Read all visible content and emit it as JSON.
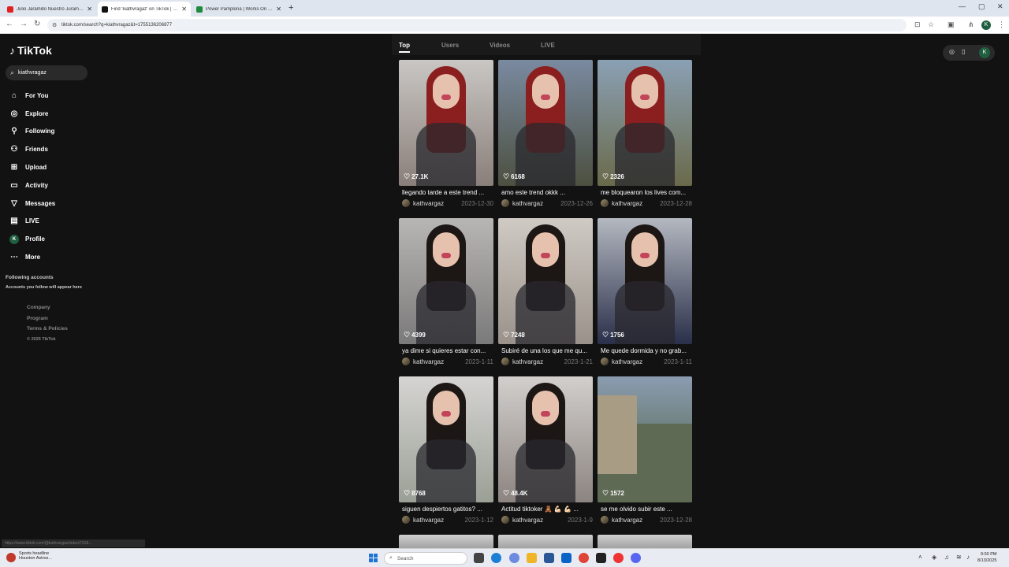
{
  "browser": {
    "tabs": [
      {
        "title": "Julio Jaramillo Nuestro Juramento",
        "favicon_color": "#e32020"
      },
      {
        "title": "Find 'kiathvragaz' on TikTok | TikTok Search",
        "favicon_color": "#111111"
      },
      {
        "title": "Power Pamplona | Works On C...",
        "favicon_color": "#1e8a3e"
      }
    ],
    "new_tab": "+",
    "url": "tiktok.com/search?q=kiathvragaz&t=1755136206877"
  },
  "sidebar": {
    "logo": "TikTok",
    "search_value": "kiathvragaz",
    "nav": [
      {
        "label": "For You",
        "icon": "home-icon"
      },
      {
        "label": "Explore",
        "icon": "compass-icon"
      },
      {
        "label": "Following",
        "icon": "following-icon"
      },
      {
        "label": "Friends",
        "icon": "friends-icon"
      },
      {
        "label": "Upload",
        "icon": "upload-icon"
      },
      {
        "label": "Activity",
        "icon": "activity-icon"
      },
      {
        "label": "Messages",
        "icon": "messages-icon"
      },
      {
        "label": "LIVE",
        "icon": "live-icon"
      },
      {
        "label": "Profile",
        "icon": "profile-avatar",
        "avatar_letter": "K"
      },
      {
        "label": "More",
        "icon": "more-icon"
      }
    ],
    "following_title": "Following accounts",
    "following_sub": "Accounts you follow will appear here",
    "footer": [
      "Company",
      "Program",
      "Terms & Policies"
    ],
    "copyright": "© 2025 TikTok"
  },
  "search_tabs": [
    "Top",
    "Users",
    "Videos",
    "LIVE"
  ],
  "results": [
    {
      "likes": "27.1K",
      "caption": "llegando tarde a este trend ...",
      "user": "kathvargaz",
      "date": "2023-12-30",
      "bg": [
        "#c9c6c3",
        "#8a7f7a"
      ],
      "hair": "#8b1e1e"
    },
    {
      "likes": "6168",
      "caption": "amo este trend okkk ...",
      "user": "kathvargaz",
      "date": "2023-12-26",
      "bg": [
        "#7a8aa0",
        "#4c5040"
      ],
      "hair": "#8b1e1e"
    },
    {
      "likes": "2326",
      "caption": "me bloquearon los lives com...",
      "user": "kathvargaz",
      "date": "2023-12-28",
      "bg": [
        "#8aa0b4",
        "#6a6a4a"
      ],
      "hair": "#8b1e1e"
    },
    {
      "likes": "4399",
      "caption": "ya dime si quieres estar con...",
      "user": "kathvargaz",
      "date": "2023-1-11",
      "bg": [
        "#b8b6b4",
        "#7b7a7a"
      ],
      "hair": "#1c1614"
    },
    {
      "likes": "7248",
      "caption": "Subiré de una los que me qu...",
      "user": "kathvargaz",
      "date": "2023-1-21",
      "bg": [
        "#cfcac4",
        "#9a928a"
      ],
      "hair": "#1c1614"
    },
    {
      "likes": "1756",
      "caption": "Me quede dormida y no grab...",
      "user": "kathvargaz",
      "date": "2023-1-11",
      "bg": [
        "#b4b8c0",
        "#2a2f4a"
      ],
      "hair": "#1c1614"
    },
    {
      "likes": "8768",
      "caption": "siguen despiertos gatitos? ...",
      "user": "kathvargaz",
      "date": "2023-1-12",
      "bg": [
        "#d6d4d2",
        "#9aa096"
      ],
      "hair": "#1c1614"
    },
    {
      "likes": "48.4K",
      "caption": "Actitud tiktoker 🧸 💪🏻 💪🏻 ...",
      "user": "kathvargaz",
      "date": "2023-1-9",
      "bg": [
        "#d2cfcc",
        "#8c8480"
      ],
      "hair": "#1c1614"
    },
    {
      "likes": "1572",
      "caption": "se me olvido subir este ...",
      "user": "kathvargaz",
      "date": "2023-12-28",
      "bg": [
        "#8a9cb0",
        "#4a5a3a"
      ],
      "hair": "none"
    }
  ],
  "status_url": "https://www.tiktok.com/@kathvargaz/video/7318...",
  "taskbar": {
    "news_title": "Sports headline",
    "news_sub": "Houston Astros...",
    "search_placeholder": "Search",
    "time": "9:50 PM",
    "date": "8/13/2025"
  }
}
